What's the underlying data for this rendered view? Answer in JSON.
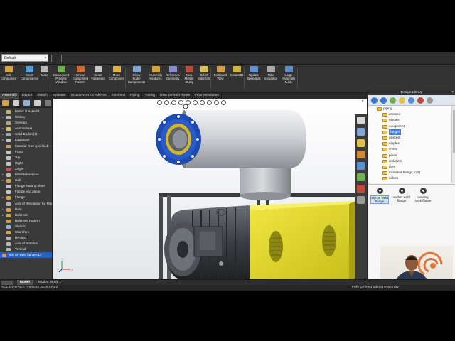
{
  "config": {
    "selected": "Default"
  },
  "ribbon": [
    {
      "label": "Edit\nComponent",
      "color": "#d9a23b"
    },
    {
      "label": "Insert\nComponents",
      "color": "#57a0d8"
    },
    {
      "label": "Mate",
      "color": "#b9b9b9"
    },
    {
      "label": "Component\nPreview\nWindow",
      "color": "#6fb24f"
    },
    {
      "label": "Linear\nComponent\nPattern",
      "color": "#d26b35"
    },
    {
      "label": "Smart\nFasteners",
      "color": "#c9c9c9"
    },
    {
      "label": "Move\nComponent",
      "color": "#e0b040"
    },
    {
      "label": "Show\nHidden\nComponents",
      "color": "#7fa7d6"
    },
    {
      "label": "Assembly\nFeatures",
      "color": "#d4a23c"
    },
    {
      "label": "Reference\nGeometry",
      "color": "#8a8ad0"
    },
    {
      "label": "New\nMotion\nStudy",
      "color": "#c24a3a"
    },
    {
      "label": "Bill of\nMaterials",
      "color": "#d9c05a"
    },
    {
      "label": "Exploded\nView",
      "color": "#d8a040"
    },
    {
      "label": "Instant3D",
      "color": "#d2b53d"
    },
    {
      "label": "Update\nSpeedpak",
      "color": "#5f95d5"
    },
    {
      "label": "Take\nSnapshot",
      "color": "#aaaaaa"
    },
    {
      "label": "Large\nAssembly\nMode",
      "color": "#5a8fd0"
    }
  ],
  "tabs": [
    "Assembly",
    "Layout",
    "Sketch",
    "Evaluate",
    "SOLIDWORKS Add-Ins",
    "Electrical",
    "Piping",
    "Tubing",
    "User Defined Route",
    "Flow Simulation"
  ],
  "feature_tree": [
    {
      "label": "Mates in Assem1",
      "icon": "#c9b45e",
      "expand": ""
    },
    {
      "label": "History",
      "icon": "#bbbbbb",
      "expand": "▸"
    },
    {
      "label": "Sensors",
      "icon": "#b9a16a",
      "expand": ""
    },
    {
      "label": "Annotations",
      "icon": "#e0c04a",
      "expand": "▸"
    },
    {
      "label": "Solid Bodies(1)",
      "icon": "#9aa3b5",
      "expand": "▸"
    },
    {
      "label": "Equations",
      "icon": "#c0c0c0",
      "expand": "▸"
    },
    {
      "label": "Material <not specified>",
      "icon": "#c9a15a",
      "expand": ""
    },
    {
      "label": "Front",
      "icon": "#c4c4c4",
      "expand": ""
    },
    {
      "label": "Top",
      "icon": "#c4c4c4",
      "expand": ""
    },
    {
      "label": "Right",
      "icon": "#c4c4c4",
      "expand": ""
    },
    {
      "label": "Origin",
      "icon": "#d14c4c",
      "expand": ""
    },
    {
      "label": "MateReferences",
      "icon": "#b9b9b9",
      "expand": "▸"
    },
    {
      "label": "Hub",
      "icon": "#d9a040",
      "expand": "▸"
    },
    {
      "label": "Flange starting plane",
      "icon": "#c4c4c4",
      "expand": ""
    },
    {
      "label": "Flange end plane",
      "icon": "#c4c4c4",
      "expand": ""
    },
    {
      "label": "Flange",
      "icon": "#d9a040",
      "expand": "▸"
    },
    {
      "label": "Axis of Revolution for Flange",
      "icon": "#b4b4b4",
      "expand": ""
    },
    {
      "label": "Bore",
      "icon": "#d9a040",
      "expand": "▸"
    },
    {
      "label": "Bolt Hole",
      "icon": "#d9a040",
      "expand": "▸"
    },
    {
      "label": "Bolt Hole Pattern",
      "icon": "#d9a040",
      "expand": ""
    },
    {
      "label": "Sketch1",
      "icon": "#8fb0d8",
      "expand": ""
    },
    {
      "label": "Chamfer1",
      "icon": "#d9a040",
      "expand": ""
    },
    {
      "label": "RPoint1",
      "icon": "#b4b4b4",
      "expand": ""
    },
    {
      "label": "Axis of Rotation",
      "icon": "#b4b4b4",
      "expand": ""
    },
    {
      "label": "Vertical",
      "icon": "#b4b4b4",
      "expand": ""
    }
  ],
  "feature_tree_selected": "slip on weld flange<1>",
  "design_library": {
    "title": "Design Library",
    "tree": [
      {
        "label": "piping",
        "depth": 0,
        "selected": false
      },
      {
        "label": "crosses",
        "depth": 1,
        "selected": false
      },
      {
        "label": "elbows",
        "depth": 1,
        "selected": false
      },
      {
        "label": "equipment",
        "depth": 1,
        "selected": false
      },
      {
        "label": "flanges",
        "depth": 1,
        "selected": true
      },
      {
        "label": "gaskets",
        "depth": 1,
        "selected": false
      },
      {
        "label": "nipples",
        "depth": 1,
        "selected": false
      },
      {
        "label": "o-lets",
        "depth": 1,
        "selected": false
      },
      {
        "label": "pipes",
        "depth": 1,
        "selected": false
      },
      {
        "label": "reducers",
        "depth": 1,
        "selected": false
      },
      {
        "label": "tees",
        "depth": 1,
        "selected": false
      },
      {
        "label": "threaded fittings (npt)",
        "depth": 1,
        "selected": false
      },
      {
        "label": "valves",
        "depth": 1,
        "selected": false
      }
    ],
    "items": [
      {
        "label": "slip on weld\nflange",
        "selected": true
      },
      {
        "label": "socket weld\nflange",
        "selected": false
      },
      {
        "label": "welding\nneck flange",
        "selected": false
      }
    ]
  },
  "bottom_tabs": [
    "Model",
    "Motion Study 1"
  ],
  "status": {
    "left": "SOLIDWORKS Premium 2019 SP3.0",
    "right": "Fully Defined   Editing Assembly"
  },
  "colors": {
    "selection": "#1f63c6",
    "motor_body": "#3c3f44",
    "enclosure_yellow": "#e4da2a",
    "flange_blue": "#1f4fb8",
    "pipe_gray": "#c9ccd1"
  }
}
